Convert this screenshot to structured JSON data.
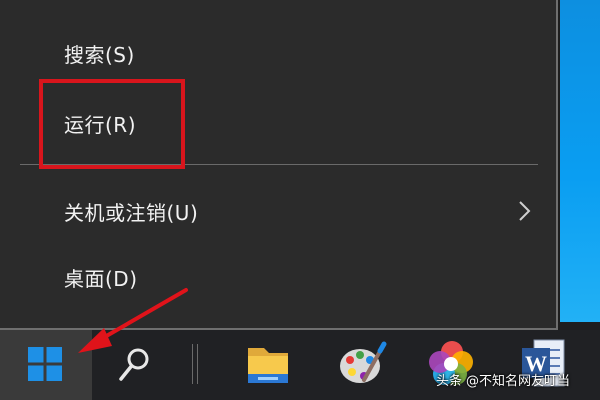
{
  "menu": {
    "items": [
      {
        "label": "搜索(S)"
      },
      {
        "label": "运行(R)"
      },
      {
        "label": "关机或注销(U)"
      },
      {
        "label": "桌面(D)"
      }
    ]
  },
  "taskbar": {
    "apps": [
      {
        "icon": "file-explorer-icon"
      },
      {
        "icon": "paint-icon"
      },
      {
        "icon": "photos-icon"
      },
      {
        "icon": "word-icon",
        "label": "W"
      }
    ]
  },
  "watermark": {
    "brand": "头条",
    "handle": "@不知名网友叮当"
  },
  "colors": {
    "menu_bg": "#2b2b2b",
    "taskbar_bg": "#202124",
    "highlight_red": "#d8151c",
    "windows_blue": "#1e90e6"
  }
}
